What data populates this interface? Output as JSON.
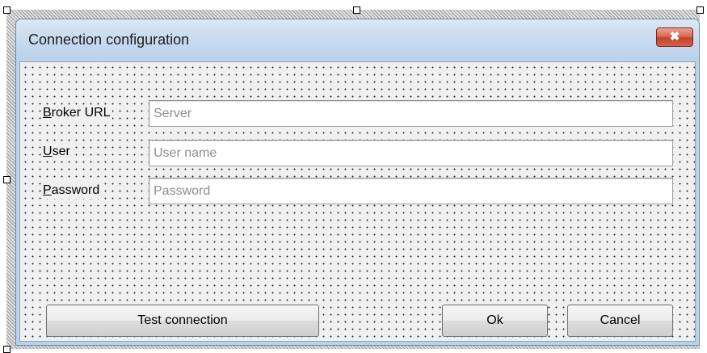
{
  "dialog": {
    "title": "Connection configuration",
    "close_icon": "close-x-icon",
    "close_glyph": "✖",
    "close_color": "#c2432b"
  },
  "form": {
    "broker_url": {
      "label": "Broker URL",
      "access_key": "B",
      "rest": "roker URL",
      "placeholder": "Server",
      "value": ""
    },
    "user": {
      "label": "User",
      "access_key": "U",
      "rest": "ser",
      "placeholder": "User name",
      "value": ""
    },
    "password": {
      "label": "Password",
      "access_key": "P",
      "rest": "assword",
      "placeholder": "Password",
      "value": ""
    }
  },
  "buttons": {
    "test_label": "Test connection",
    "ok_label": "Ok",
    "cancel_label": "Cancel"
  }
}
